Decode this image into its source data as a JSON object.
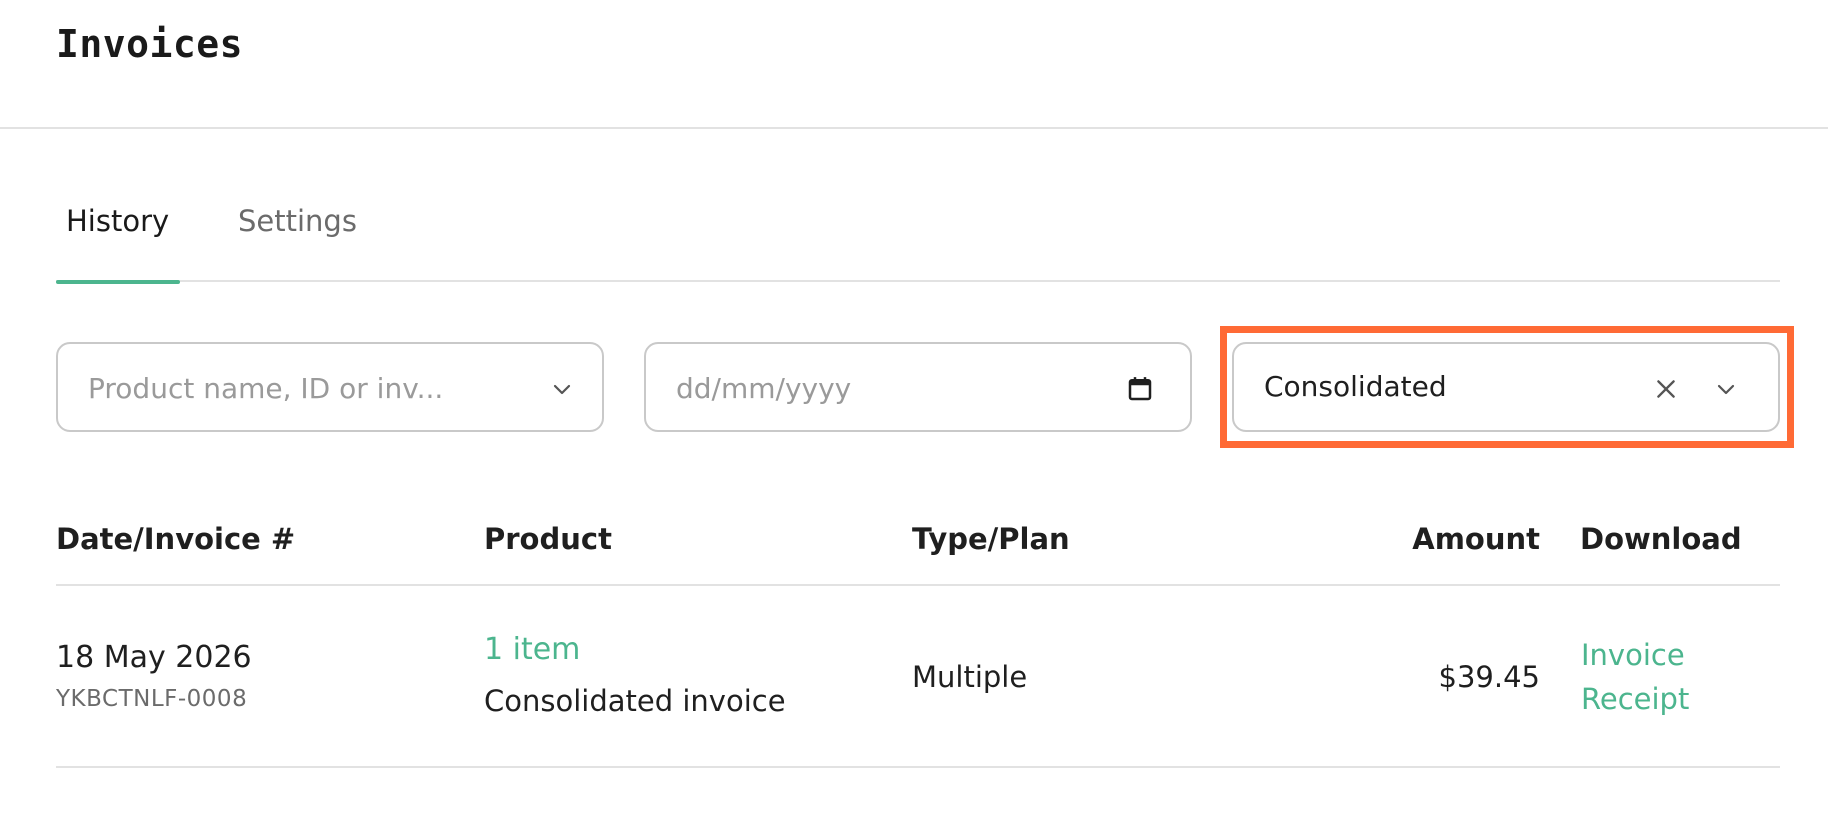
{
  "header": {
    "title": "Invoices"
  },
  "tabs": [
    {
      "label": "History",
      "active": true
    },
    {
      "label": "Settings",
      "active": false
    }
  ],
  "filters": {
    "product": {
      "placeholder": "Product name, ID or inv..."
    },
    "date": {
      "placeholder": "dd/mm/yyyy"
    },
    "type": {
      "value": "Consolidated"
    }
  },
  "table": {
    "columns": [
      "Date/Invoice #",
      "Product",
      "Type/Plan",
      "Amount",
      "Download"
    ],
    "rows": [
      {
        "date": "18 May 2026",
        "invoice_id": "YKBCTNLF-0008",
        "product_link": "1 item",
        "product_desc": "Consolidated invoice",
        "type": "Multiple",
        "amount": "$39.45",
        "invoice_link": "Invoice",
        "receipt_link": "Receipt"
      }
    ]
  },
  "colors": {
    "accent": "#4cb58e",
    "highlight": "#ff6a35",
    "border": "#c9c9c9"
  },
  "icons": {
    "product_filter": "chevron-down-icon",
    "date_filter": "calendar-icon",
    "type_clear": "close-icon",
    "type_toggle": "chevron-down-icon"
  }
}
